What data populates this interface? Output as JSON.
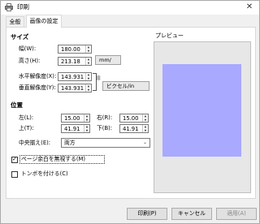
{
  "window": {
    "title": "印刷",
    "close_glyph": "✕"
  },
  "tabs": [
    {
      "label": "全般",
      "active": false
    },
    {
      "label": "画像の設定",
      "active": true
    }
  ],
  "size": {
    "heading": "サイズ",
    "width_label": "幅(W):",
    "width_value": "180.00",
    "height_label": "高さ(H):",
    "height_value": "213.18",
    "unit_mm": "mm/",
    "h_res_label": "水平解像度(X):",
    "h_res_value": "143.931",
    "v_res_label": "垂直解像度(Y):",
    "v_res_value": "143.931",
    "res_unit": "ピクセル/in"
  },
  "position": {
    "heading": "位置",
    "left_label": "左(L):",
    "left_value": "15.00",
    "right_label": "右(R):",
    "right_value": "15.00",
    "top_label": "上(T):",
    "top_value": "41.91",
    "bottom_label": "下(B):",
    "bottom_value": "41.91",
    "center_label": "中央揃え(E):",
    "center_value": "両方"
  },
  "options": {
    "ignore_margin_label": "ページ余白を無視する(M)",
    "ignore_margin_checked": true,
    "crop_marks_label": "トンボを付ける(C)",
    "crop_marks_checked": false
  },
  "preview": {
    "label": "プレビュー",
    "page_color": "#a9a9ff"
  },
  "buttons": {
    "print": "印刷(P)",
    "cancel": "キャンセル",
    "apply": "適用(A)"
  }
}
